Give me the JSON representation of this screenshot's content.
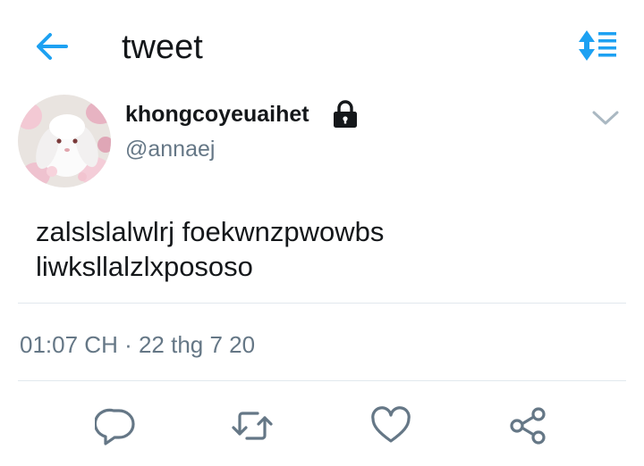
{
  "header": {
    "title": "tweet",
    "back_icon": "arrow-left-icon",
    "sort_icon": "sort-toggle-icon",
    "accent_color": "#1da1f2"
  },
  "tweet": {
    "author": {
      "display_name": "khongcoyeuaihet",
      "handle": "@annaej",
      "protected_icon": "lock-icon",
      "avatar": "bunny-with-flowers-avatar"
    },
    "text": "zalslslalwlrj foekwnzpwowbs\nliwksllalzlxpososo",
    "timestamp": "01:07 CH · 22 thg 7 20"
  },
  "actions": [
    {
      "name": "reply",
      "icon": "reply-icon"
    },
    {
      "name": "retweet",
      "icon": "retweet-icon"
    },
    {
      "name": "like",
      "icon": "heart-icon"
    },
    {
      "name": "share",
      "icon": "share-icon"
    }
  ],
  "colors": {
    "text_primary": "#14171a",
    "text_secondary": "#657786",
    "divider": "#e1e8ed",
    "action_icon": "#657786"
  }
}
